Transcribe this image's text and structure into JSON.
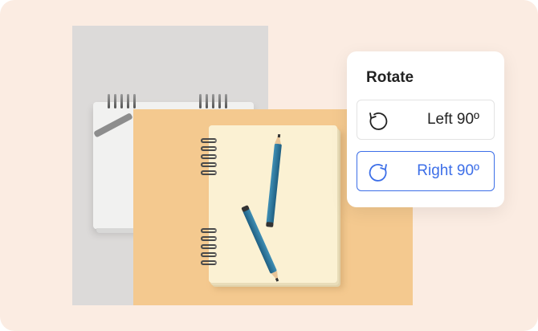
{
  "panel": {
    "title": "Rotate",
    "buttons": [
      {
        "label": "Left 90º",
        "icon": "rotate-left-icon",
        "selected": false
      },
      {
        "label": "Right 90º",
        "icon": "rotate-right-icon",
        "selected": true
      }
    ]
  },
  "colors": {
    "canvas_bg": "#fbece2",
    "accent": "#3d6fe8",
    "original_photo_bg": "#dcdad9",
    "rotated_photo_bg": "#f4c98f"
  }
}
